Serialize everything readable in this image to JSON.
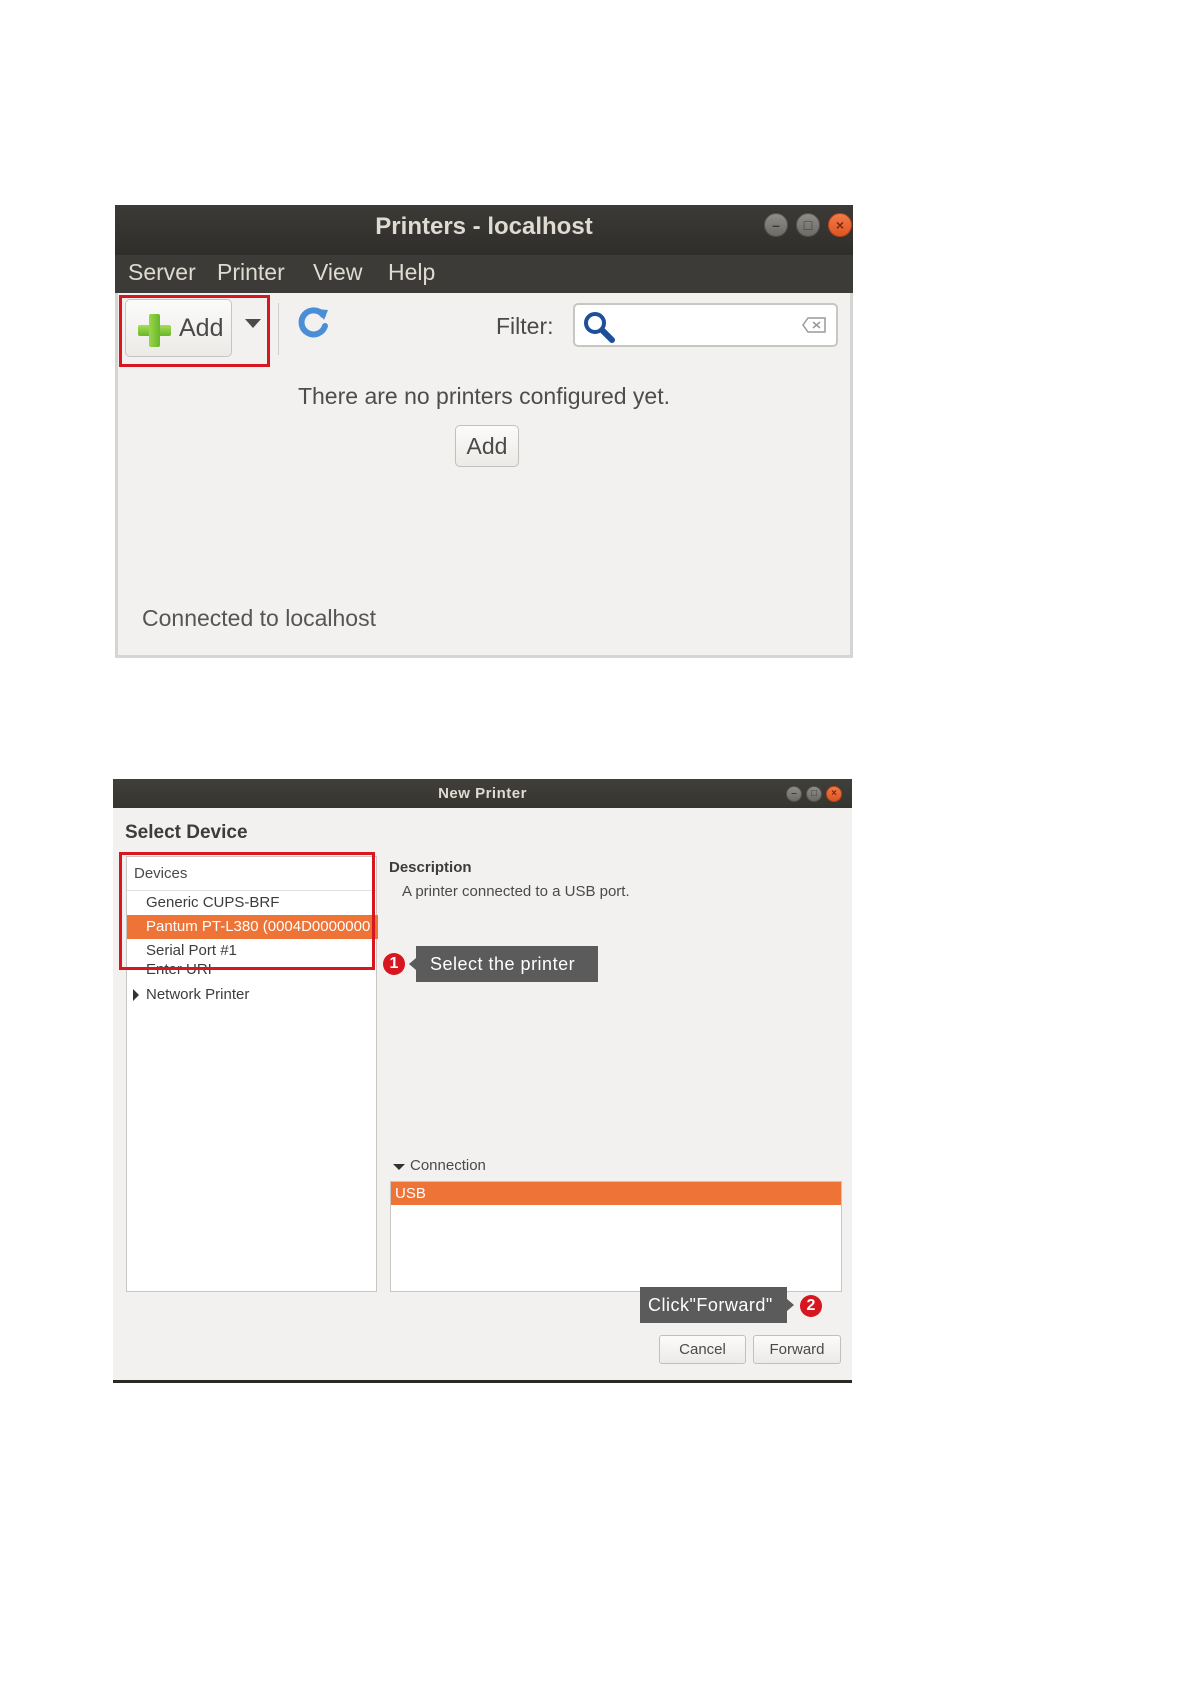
{
  "window1": {
    "title": "Printers - localhost",
    "menu": [
      "Server",
      "Printer",
      "View",
      "Help"
    ],
    "toolbar": {
      "add_label": "Add",
      "filter_label": "Filter:",
      "filter_value": ""
    },
    "empty_message": "There are no printers configured yet.",
    "add_button": "Add",
    "status": "Connected to localhost"
  },
  "window2": {
    "title": "New Printer",
    "section_title": "Select Device",
    "devices_header": "Devices",
    "devices": [
      "Generic CUPS-BRF",
      "Pantum PT-L380 (0004D0000000",
      "Serial Port #1",
      "Enter URI",
      "Network Printer"
    ],
    "selected_device_index": 1,
    "description_heading": "Description",
    "description_text": "A printer connected to a USB port.",
    "connection_heading": "Connection",
    "connection_value": "USB",
    "cancel_label": "Cancel",
    "forward_label": "Forward"
  },
  "annotations": {
    "step1_number": "1",
    "step1_text": "Select the printer",
    "step2_number": "2",
    "step2_text": "Click\"Forward\""
  },
  "colors": {
    "accent": "#ee7336",
    "highlight": "#d7161f",
    "titlebar": "#3c3b37"
  }
}
